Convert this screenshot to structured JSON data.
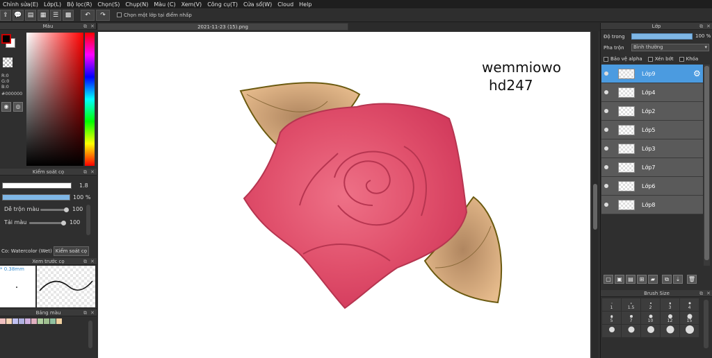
{
  "menu": [
    "Chỉnh sửa(E)",
    "Lớp(L)",
    "Bộ lọc(R)",
    "Chọn(S)",
    "Chụp(N)",
    "Màu (C)",
    "Xem(V)",
    "Công cụ(T)",
    "Cửa sổ(W)",
    "Cloud",
    "Help"
  ],
  "toolbar": {
    "hint": "Chọn một lớp tại điểm nhấp"
  },
  "color_panel": {
    "title": "Màu",
    "r": "R:0",
    "g": "G:0",
    "b": "B:0",
    "hex": "#000000"
  },
  "brush_control": {
    "title": "Kiểm soát cọ",
    "size_value": "1.8",
    "opacity_value": "100 %",
    "blend_label": "Dễ trộn màu",
    "blend_value": "100",
    "reload_label": "Tải màu",
    "reload_value": "100"
  },
  "brush_tabs": {
    "current": "Co: Watercolor (Wet)",
    "control": "Kiểm soát cọ"
  },
  "brush_preview": {
    "title": "Xem trước cọ",
    "size": "* 0.38mm"
  },
  "palette": {
    "title": "Bảng màu",
    "colors": [
      "#f0c0c0",
      "#f5d5b5",
      "#c0c0f0",
      "#b0b0e0",
      "#d0b0e0",
      "#e0b0c0",
      "#b0d0a0",
      "#a0c090",
      "#90c0a0",
      "#f0d0a0"
    ]
  },
  "document": {
    "tab": "2021-11-23 (15).png",
    "signature_line1": "wemmiowo",
    "signature_line2": "hd247"
  },
  "layers_panel": {
    "title": "Lớp",
    "opacity_label": "Độ trong",
    "opacity_value": "100 %",
    "blend_label": "Pha trộn",
    "blend_value": "Bình thường",
    "opt_alpha": "Bảo vệ alpha",
    "opt_clip": "Xén bớt",
    "opt_lock": "Khóa",
    "layers": [
      {
        "name": "Lớp9",
        "selected": true
      },
      {
        "name": "Lớp4",
        "selected": false
      },
      {
        "name": "Lớp2",
        "selected": false
      },
      {
        "name": "Lớp5",
        "selected": false
      },
      {
        "name": "Lớp3",
        "selected": false
      },
      {
        "name": "Lớp7",
        "selected": false
      },
      {
        "name": "Lớp6",
        "selected": false
      },
      {
        "name": "Lớp8",
        "selected": false
      }
    ]
  },
  "brush_size": {
    "title": "Brush Size",
    "sizes": [
      "1",
      "1.5",
      "2",
      "3",
      "4",
      "5",
      "7",
      "10",
      "12",
      "15",
      "",
      "",
      "",
      "",
      ""
    ]
  },
  "colors": {
    "accent": "#4b9be0",
    "rose": "#e2556e",
    "leaf": "#c9a070"
  }
}
